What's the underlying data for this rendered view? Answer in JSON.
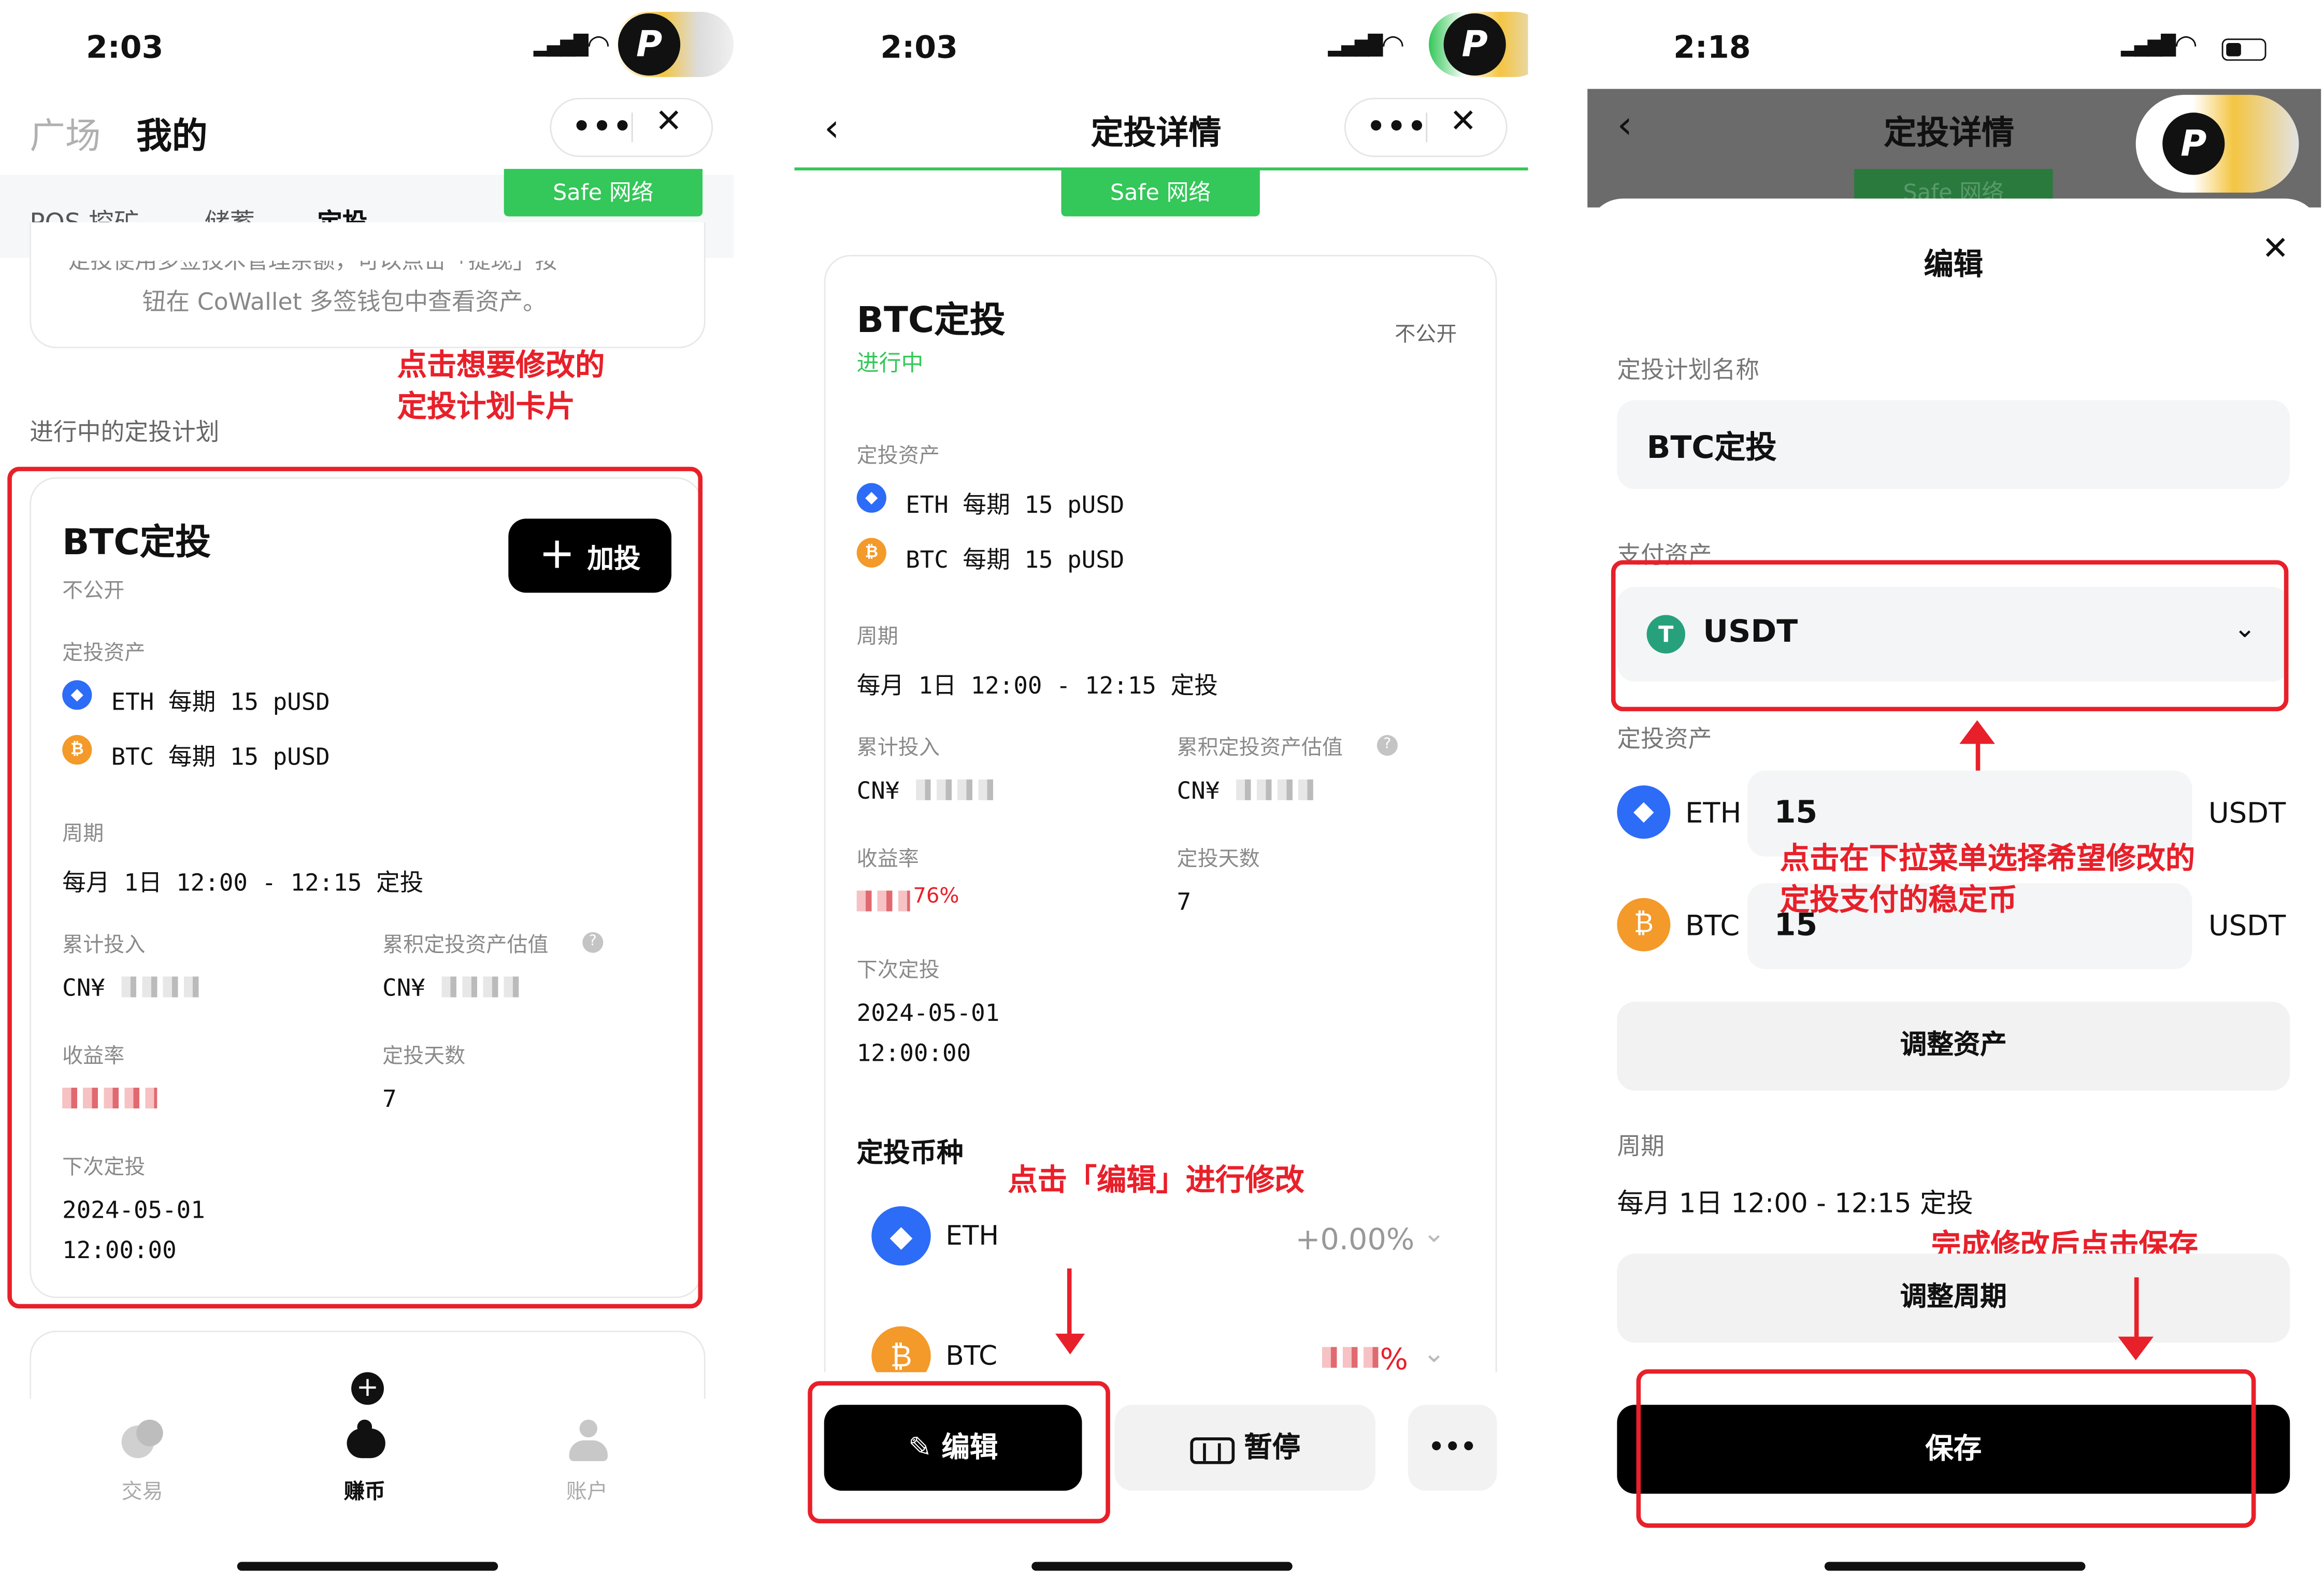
{
  "panel1": {
    "time": "2:03",
    "tabs_top": {
      "plaza": "广场",
      "mine": "我的"
    },
    "capsule": {
      "more": "•••",
      "close": "✕"
    },
    "safe_badge": "Safe 网络",
    "subtabs": [
      "POS 挖矿",
      "储蓄",
      "定投"
    ],
    "notice_top": "定投使用多签技术管理余额，可以点击「提现」按",
    "notice_bottom": "钮在 CoWallet 多签钱包中查看资产。",
    "section_title": "进行中的定投计划",
    "annotation": [
      "点击想要修改的",
      "定投计划卡片"
    ],
    "card": {
      "title": "BTC定投",
      "visibility": "不公开",
      "add_button": "加投",
      "assets_label": "定投资产",
      "assets": [
        {
          "coin": "ETH",
          "text": "ETH 每期 15 pUSD"
        },
        {
          "coin": "BTC",
          "text": "BTC 每期 15 pUSD"
        }
      ],
      "period_label": "周期",
      "period": "每月 1日 12:00 - 12:15 定投",
      "invested_label": "累计投入",
      "invested_value": "CN¥",
      "estimate_label": "累积定投资产估值",
      "estimate_value": "CN¥",
      "yield_label": "收益率",
      "days_label": "定投天数",
      "days_value": "7",
      "next_label": "下次定投",
      "next_date": "2024-05-01",
      "next_time": "12:00:00"
    },
    "nav": [
      {
        "label": "交易",
        "icon": "trade-icon"
      },
      {
        "label": "赚币",
        "icon": "earn-icon"
      },
      {
        "label": "账户",
        "icon": "account-icon"
      }
    ]
  },
  "panel2": {
    "time": "2:03",
    "header_title": "定投详情",
    "safe_badge": "Safe 网络",
    "card": {
      "title": "BTC定投",
      "status": "进行中",
      "visibility": "不公开",
      "assets_label": "定投资产",
      "assets": [
        {
          "coin": "ETH",
          "text": "ETH 每期 15 pUSD"
        },
        {
          "coin": "BTC",
          "text": "BTC 每期 15 pUSD"
        }
      ],
      "period_label": "周期",
      "period": "每月 1日 12:00 - 12:15 定投",
      "invested_label": "累计投入",
      "invested_value": "CN¥",
      "estimate_label": "累积定投资产估值",
      "estimate_value": "CN¥",
      "yield_label": "收益率",
      "yield_value": "76%",
      "days_label": "定投天数",
      "days_value": "7",
      "next_label": "下次定投",
      "next_date": "2024-05-01",
      "next_time": "12:00:00",
      "coins_label": "定投币种",
      "coin_rows": [
        {
          "name": "ETH",
          "change": "+0.00%"
        },
        {
          "name": "BTC",
          "change": "%"
        }
      ]
    },
    "annotation": "点击「编辑」进行修改",
    "edit_button": "编辑",
    "pause_button": "暂停",
    "more_button": "•••"
  },
  "panel3": {
    "time": "2:18",
    "header_title": "定投详情",
    "safe_badge": "Safe 网络",
    "sheet_title": "编辑",
    "name_label": "定投计划名称",
    "name_value": "BTC定投",
    "pay_label": "支付资产",
    "pay_value": "USDT",
    "assets_label": "定投资产",
    "asset_rows": [
      {
        "coin": "ETH",
        "amount": "15",
        "unit": "USDT"
      },
      {
        "coin": "BTC",
        "amount": "15",
        "unit": "USDT"
      }
    ],
    "adjust_assets": "调整资产",
    "period_label": "周期",
    "period_value": "每月 1日 12:00 - 12:15 定投",
    "adjust_period": "调整周期",
    "save_button": "保存",
    "annotation_dropdown": [
      "点击在下拉菜单选择希望修改的",
      "定投支付的稳定币"
    ],
    "annotation_save": "完成修改后点击保存"
  },
  "colors": {
    "accent_green": "#34c759",
    "annotation_red": "#e8202a",
    "eth_blue": "#2d6cf6",
    "btc_orange": "#f39a2a"
  }
}
